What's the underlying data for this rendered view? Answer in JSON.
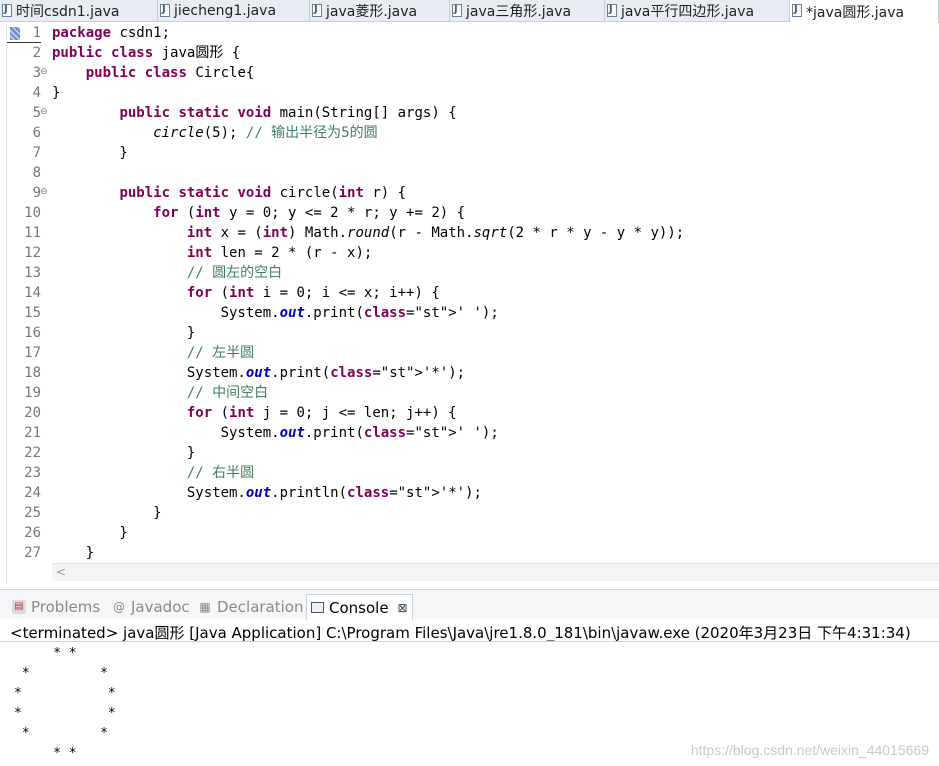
{
  "tabs": [
    {
      "label": "时间csdn1.java",
      "active": false
    },
    {
      "label": "jiecheng1.java",
      "active": false
    },
    {
      "label": "java菱形.java",
      "active": false
    },
    {
      "label": "java三角形.java",
      "active": false
    },
    {
      "label": "java平行四边形.java",
      "active": false
    },
    {
      "label": "*java圆形.java",
      "active": true
    }
  ],
  "editor": {
    "line_numbers": [
      "1",
      "2",
      "3",
      "4",
      "5",
      "6",
      "7",
      "8",
      "9",
      "10",
      "11",
      "12",
      "13",
      "14",
      "15",
      "16",
      "17",
      "18",
      "19",
      "20",
      "21",
      "22",
      "23",
      "24",
      "25",
      "26",
      "27"
    ],
    "folded_lines": [
      "3",
      "5",
      "9"
    ],
    "code_lines": [
      "package csdn1;",
      "public class java圆形 {",
      "    public class Circle{",
      "}",
      "        public static void main(String[] args) {",
      "            circle(5); // 输出半径为5的圆",
      "        }",
      "",
      "        public static void circle(int r) {",
      "            for (int y = 0; y <= 2 * r; y += 2) {",
      "                int x = (int) Math.round(r - Math.sqrt(2 * r * y - y * y));",
      "                int len = 2 * (r - x);",
      "                // 圆左的空白",
      "                for (int i = 0; i <= x; i++) {",
      "                    System.out.print(' ');",
      "                }",
      "                // 左半圆",
      "                System.out.print('*');",
      "                // 中间空白",
      "                for (int j = 0; j <= len; j++) {",
      "                    System.out.print(' ');",
      "                }",
      "                // 右半圆",
      "                System.out.println('*');",
      "            }",
      "        }",
      "    }"
    ]
  },
  "panel": {
    "tabs": [
      {
        "label": "Problems",
        "icon": "problems-icon",
        "active": false
      },
      {
        "label": "Javadoc",
        "icon": "at-icon",
        "active": false
      },
      {
        "label": "Declaration",
        "icon": "declaration-icon",
        "active": false
      },
      {
        "label": "Console",
        "icon": "console-icon",
        "active": true
      }
    ],
    "status": "<terminated> java圆形 [Java Application] C:\\Program Files\\Java\\jre1.8.0_181\\bin\\javaw.exe (2020年3月23日 下午4:31:34)",
    "output": [
      "     * *",
      " *         *",
      "*           *",
      "*           *",
      " *         *",
      "     * *"
    ]
  },
  "watermark": "https://blog.csdn.net/weixin_44015669"
}
